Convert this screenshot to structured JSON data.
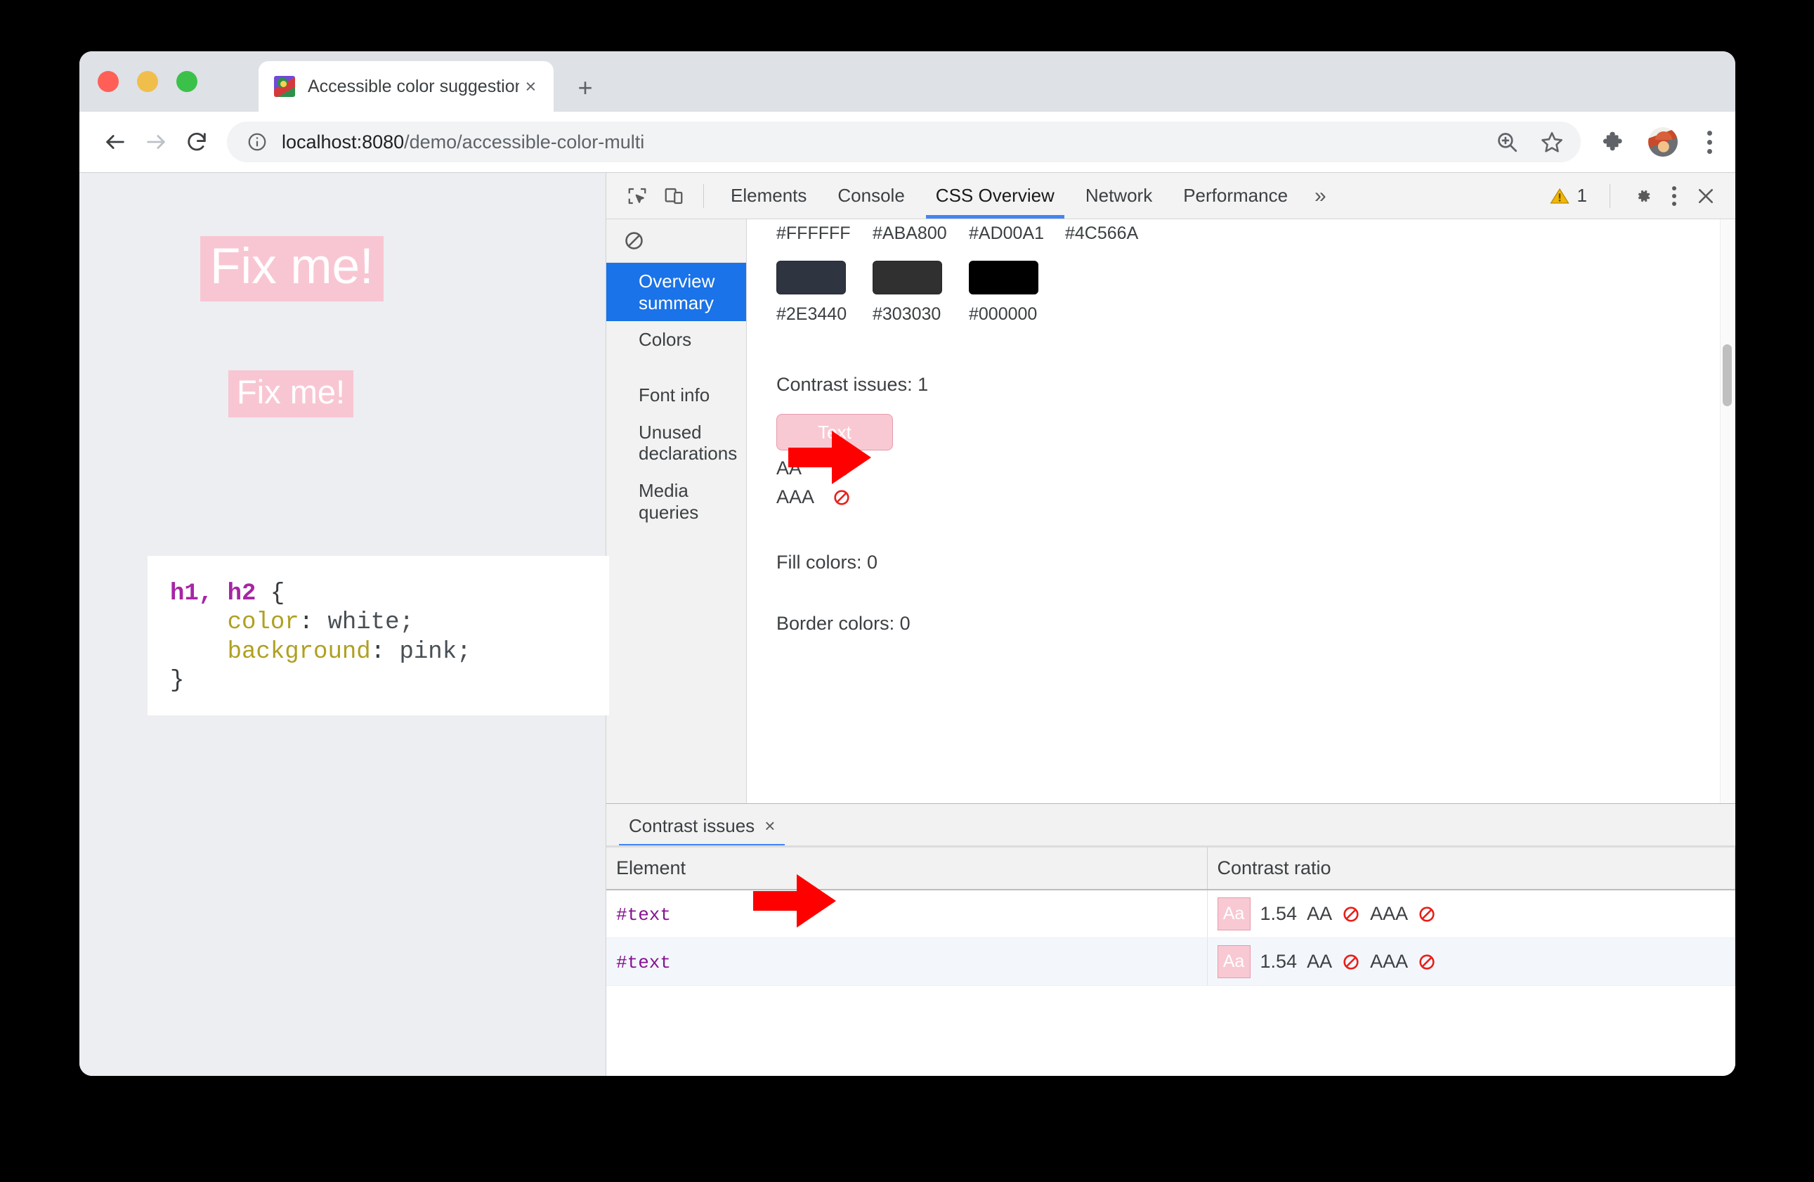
{
  "browser": {
    "tab": {
      "title": "Accessible color suggestion",
      "close_label": "×",
      "favicon": "dino-favicon"
    },
    "new_tab_label": "+",
    "omnibox": {
      "info_icon": "info-circle-icon",
      "url_host": "localhost:8080",
      "url_path": "/demo/accessible-color-multi",
      "zoom_icon": "zoom-in-icon",
      "bookmark_icon": "star-icon"
    },
    "toolbar_right": {
      "extensions_icon": "puzzle-piece-icon",
      "avatar": "profile-avatar",
      "menu_icon": "three-dot-menu-icon"
    },
    "nav": {
      "back_icon": "arrow-left-icon",
      "forward_icon": "arrow-right-icon",
      "reload_icon": "reload-icon"
    }
  },
  "page": {
    "h1": "Fix me!",
    "h2": "Fix me!",
    "code": {
      "line1_selector": "h1, h2",
      "line1_brace": " {",
      "line2_prop": "color",
      "line2_val": " white;",
      "line3_prop": "background",
      "line3_val": " pink;",
      "line4": "}"
    }
  },
  "devtools": {
    "inspect_icon": "inspect-element-icon",
    "device_icon": "device-toolbar-icon",
    "tabs": [
      {
        "label": "Elements",
        "active": false
      },
      {
        "label": "Console",
        "active": false
      },
      {
        "label": "CSS Overview",
        "active": true
      },
      {
        "label": "Network",
        "active": false
      },
      {
        "label": "Performance",
        "active": false
      }
    ],
    "more_tabs_label": "»",
    "warning_icon": "warning-triangle-icon",
    "warning_count": "1",
    "settings_icon": "gear-icon",
    "kebab_icon": "three-dot-menu-icon",
    "close_icon": "close-icon",
    "css_overview": {
      "clear_icon": "clear-overview-icon",
      "sidebar": [
        {
          "label": "Overview summary",
          "active": true
        },
        {
          "label": "Colors",
          "active": false
        },
        {
          "label": "Font info",
          "active": false
        },
        {
          "label": "Unused declarations",
          "active": false
        },
        {
          "label": "Media queries",
          "active": false
        }
      ],
      "top_row_hex": [
        "#FFFFFF",
        "#ABA800",
        "#AD00A1",
        "#4C566A"
      ],
      "swatches": [
        {
          "hex": "#2E3440",
          "color": "#2E3440"
        },
        {
          "hex": "#303030",
          "color": "#303030"
        },
        {
          "hex": "#000000",
          "color": "#000000"
        }
      ],
      "contrast_issues_label": "Contrast issues: 1",
      "text_chip_label": "Text",
      "aa_label": "AA",
      "aaa_label": "AAA",
      "aa_status_icon": "no-entry-icon",
      "aaa_status_icon": "no-entry-icon",
      "fill_colors_label": "Fill colors: 0",
      "border_colors_label": "Border colors: 0"
    },
    "drawer": {
      "tab_label": "Contrast issues",
      "tab_close": "×",
      "table": {
        "columns": [
          "Element",
          "Contrast ratio"
        ],
        "rows": [
          {
            "element": "#text",
            "swatch_label": "Aa",
            "ratio": "1.54",
            "aa": "AA",
            "aa_icon": "no-entry-icon",
            "aaa": "AAA",
            "aaa_icon": "no-entry-icon"
          },
          {
            "element": "#text",
            "swatch_label": "Aa",
            "ratio": "1.54",
            "aa": "AA",
            "aa_icon": "no-entry-icon",
            "aaa": "AAA",
            "aaa_icon": "no-entry-icon"
          }
        ]
      }
    }
  },
  "annotations": {
    "arrow1": "red-arrow-pointing-to-text-chip",
    "arrow2": "red-arrow-pointing-to-contrast-table"
  },
  "colors": {
    "accent_blue": "#1a73e8",
    "arrow_red": "#ff0000",
    "pink_bg": "#f8c6d2",
    "issue_red": "#e8201c"
  }
}
